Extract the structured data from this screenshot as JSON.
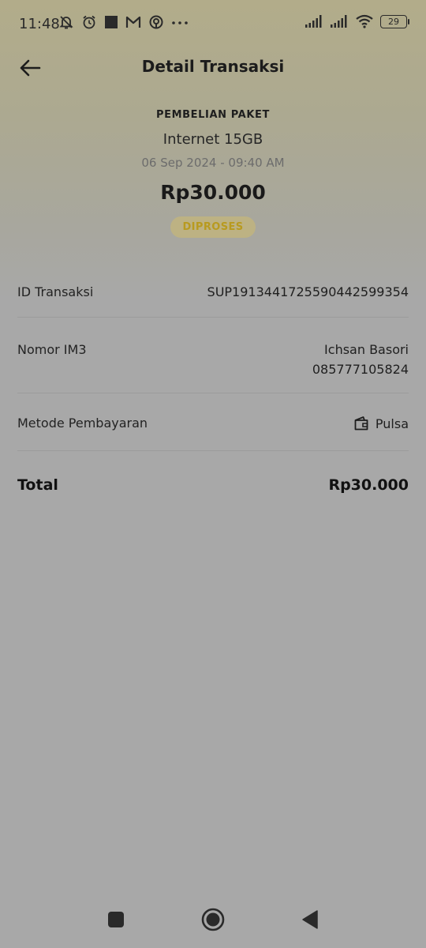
{
  "status_bar": {
    "time": "11:48",
    "battery": "29"
  },
  "header": {
    "title": "Detail Transaksi"
  },
  "summary": {
    "category": "PEMBELIAN PAKET",
    "product": "Internet 15GB",
    "datetime": "06 Sep 2024 - 09:40 AM",
    "amount": "Rp30.000",
    "status": "DIPROSES"
  },
  "details": {
    "transaction_id_label": "ID Transaksi",
    "transaction_id_value": "SUP1913441725590442599354",
    "number_label": "Nomor IM3",
    "number_name": "Ichsan Basori",
    "number_value": "085777105824",
    "payment_label": "Metode Pembayaran",
    "payment_value": "Pulsa",
    "total_label": "Total",
    "total_value": "Rp30.000"
  },
  "colors": {
    "badge_text": "#b89a1f",
    "badge_bg": "#bdb283",
    "accent": "#f5c400"
  },
  "icons": [
    "mute-bell-icon",
    "alarm-icon",
    "square-icon",
    "gmail-icon",
    "app-icon",
    "more-dots-icon",
    "signal-icon",
    "wifi-icon",
    "battery-icon",
    "back-arrow-icon",
    "wallet-icon",
    "recent-apps-icon",
    "home-icon",
    "back-triangle-icon"
  ]
}
